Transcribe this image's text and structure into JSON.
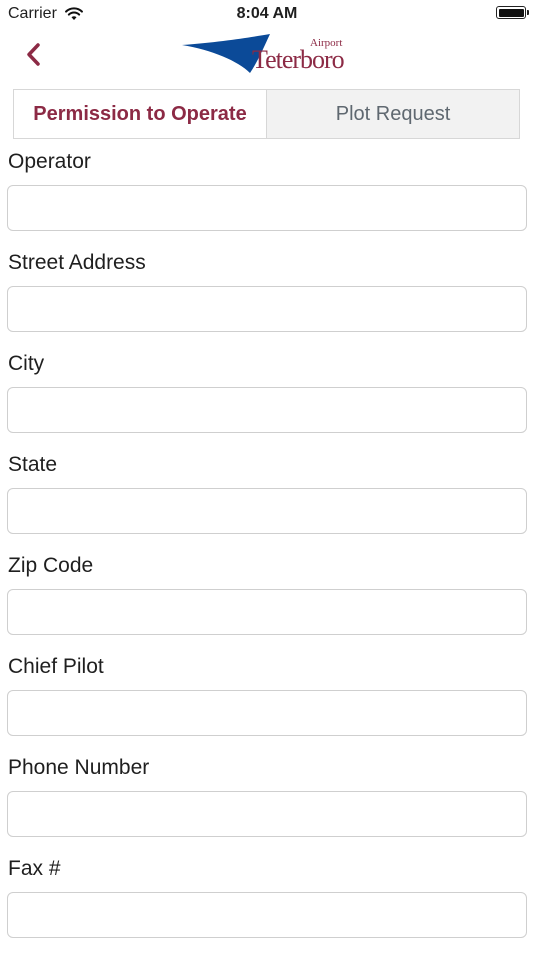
{
  "status_bar": {
    "carrier": "Carrier",
    "time": "8:04 AM"
  },
  "nav": {
    "logo_top": "Airport",
    "logo_main": "Teterboro"
  },
  "tabs": [
    {
      "label": "Permission to Operate",
      "active": true
    },
    {
      "label": "Plot Request",
      "active": false
    }
  ],
  "form": {
    "fields": [
      {
        "label": "Operator",
        "value": ""
      },
      {
        "label": "Street Address",
        "value": ""
      },
      {
        "label": "City",
        "value": ""
      },
      {
        "label": "State",
        "value": ""
      },
      {
        "label": "Zip Code",
        "value": ""
      },
      {
        "label": "Chief Pilot",
        "value": ""
      },
      {
        "label": "Phone Number",
        "value": ""
      },
      {
        "label": "Fax #",
        "value": ""
      }
    ]
  },
  "colors": {
    "accent": "#8c2a45",
    "logo_blue": "#0b4a98",
    "inactive_tab_text": "#5f6870",
    "border": "#cfcfcf"
  }
}
